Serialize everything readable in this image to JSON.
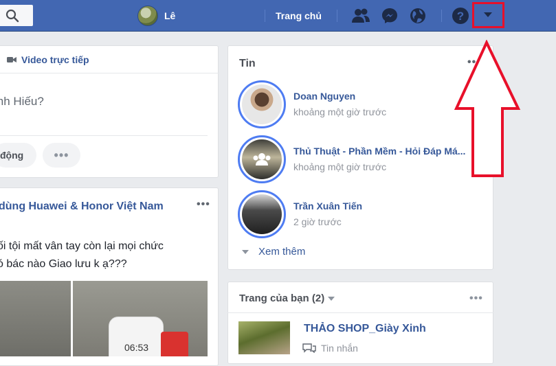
{
  "topbar": {
    "profile_name": "Lê",
    "home_label": "Trang chủ",
    "colors": {
      "bar": "#4267b2",
      "highlight_box": "#e8102a"
    },
    "icons": [
      "search-icon",
      "friend-requests-icon",
      "messenger-icon",
      "notifications-globe-icon",
      "help-icon",
      "dropdown-caret-icon"
    ]
  },
  "composer": {
    "live_video_label": "Video trực tiếp",
    "placeholder": "inh Hiếu?",
    "activity_label": "động",
    "more_label": "•••"
  },
  "post": {
    "group_name": "dùng Huawei & Honor Việt Nam",
    "more_label": "•••",
    "line1": "ối tội mất vân tay còn lại mọi chức",
    "line2": "ó bác nào Giao lưu k ạ???",
    "phone_time": "06:53"
  },
  "stories": {
    "title": "Tin",
    "more_label": "•••",
    "items": [
      {
        "name": "Doan Nguyen",
        "time": "khoảng một giờ trước"
      },
      {
        "name": "Thủ Thuật - Phần Mềm - Hỏi Đáp Má...",
        "time": "khoảng một giờ trước"
      },
      {
        "name": "Trần Xuân Tiến",
        "time": "2 giờ trước"
      }
    ],
    "see_more": "Xem thêm"
  },
  "pages": {
    "title": "Trang của bạn (2)",
    "more_label": "•••",
    "page_name": "THẢO SHOP_Giày Xinh",
    "messages_label": "Tin nhắn"
  }
}
